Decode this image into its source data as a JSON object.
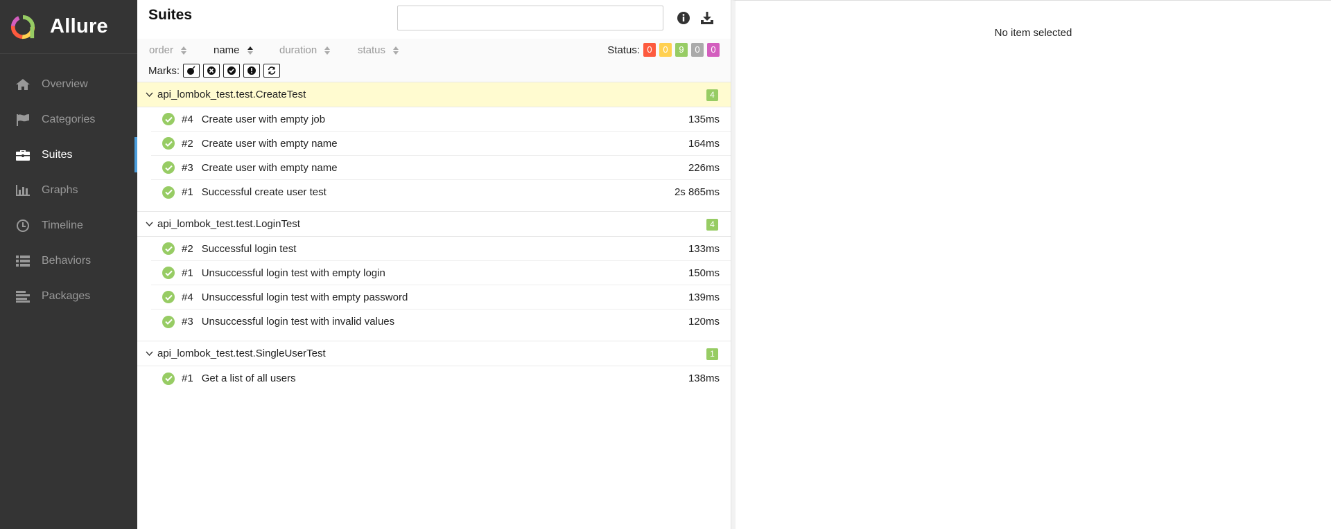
{
  "brand": {
    "name": "Allure"
  },
  "sidebar": {
    "items": [
      {
        "label": "Overview",
        "icon": "home-icon"
      },
      {
        "label": "Categories",
        "icon": "flag-icon"
      },
      {
        "label": "Suites",
        "icon": "briefcase-icon",
        "active": true
      },
      {
        "label": "Graphs",
        "icon": "bar-chart-icon"
      },
      {
        "label": "Timeline",
        "icon": "clock-icon"
      },
      {
        "label": "Behaviors",
        "icon": "list-icon"
      },
      {
        "label": "Packages",
        "icon": "align-left-icon"
      }
    ]
  },
  "pane": {
    "title": "Suites",
    "search_value": "",
    "sort": [
      {
        "label": "order"
      },
      {
        "label": "name",
        "active": true
      },
      {
        "label": "duration"
      },
      {
        "label": "status"
      }
    ],
    "status_label": "Status:",
    "status_badges": [
      {
        "value": "0",
        "color": "#fd5a3e"
      },
      {
        "value": "0",
        "color": "#ffd050"
      },
      {
        "value": "9",
        "color": "#97cc64"
      },
      {
        "value": "0",
        "color": "#aaaaaa"
      },
      {
        "value": "0",
        "color": "#d35ebe"
      }
    ],
    "marks_label": "Marks:",
    "marks": [
      "flaky-bomb-icon",
      "new-failed-icon",
      "new-passed-icon",
      "new-broken-icon",
      "retries-icon"
    ]
  },
  "groups": [
    {
      "name": "api_lombok_test.test.CreateTest",
      "count": "4",
      "highlighted": true,
      "tests": [
        {
          "num": "#4",
          "name": "Create user with empty job",
          "duration": "135ms"
        },
        {
          "num": "#2",
          "name": "Create user with empty name",
          "duration": "164ms"
        },
        {
          "num": "#3",
          "name": "Create user with empty name",
          "duration": "226ms"
        },
        {
          "num": "#1",
          "name": "Successful create user test",
          "duration": "2s 865ms"
        }
      ]
    },
    {
      "name": "api_lombok_test.test.LoginTest",
      "count": "4",
      "highlighted": false,
      "tests": [
        {
          "num": "#2",
          "name": "Successful login test",
          "duration": "133ms"
        },
        {
          "num": "#1",
          "name": "Unsuccessful login test with empty login",
          "duration": "150ms"
        },
        {
          "num": "#4",
          "name": "Unsuccessful login test with empty password",
          "duration": "139ms"
        },
        {
          "num": "#3",
          "name": "Unsuccessful login test with invalid values",
          "duration": "120ms"
        }
      ]
    },
    {
      "name": "api_lombok_test.test.SingleUserTest",
      "count": "1",
      "highlighted": false,
      "tests": [
        {
          "num": "#1",
          "name": "Get a list of all users",
          "duration": "138ms"
        }
      ]
    }
  ],
  "detail": {
    "empty_message": "No item selected"
  }
}
